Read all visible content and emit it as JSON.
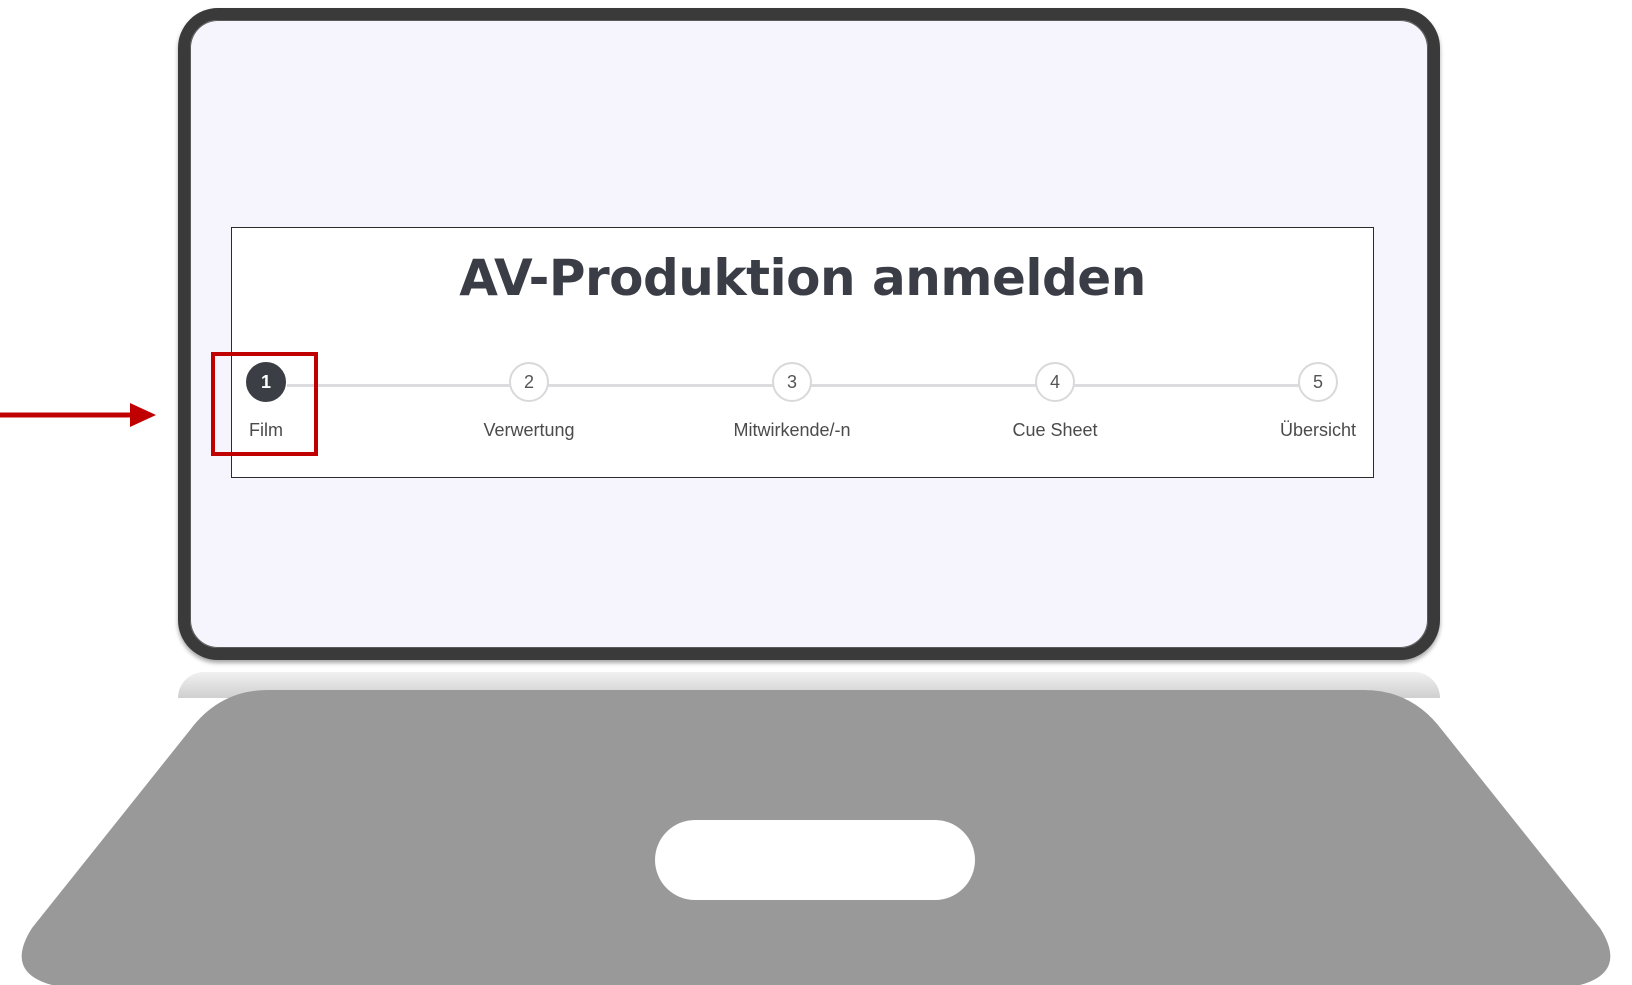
{
  "title": "AV-Produktion anmelden",
  "steps": [
    {
      "number": "1",
      "label": "Film",
      "active": true
    },
    {
      "number": "2",
      "label": "Verwertung",
      "active": false
    },
    {
      "number": "3",
      "label": "Mitwirkende/-n",
      "active": false
    },
    {
      "number": "4",
      "label": "Cue Sheet",
      "active": false
    },
    {
      "number": "5",
      "label": "Übersicht",
      "active": false
    }
  ],
  "colors": {
    "screen_background": "#f6f5fd",
    "active_step": "#3c3e46",
    "annotation": "#c00000",
    "laptop_body": "#999999"
  },
  "icons": {
    "annotation_arrow": "arrow-right-icon"
  }
}
